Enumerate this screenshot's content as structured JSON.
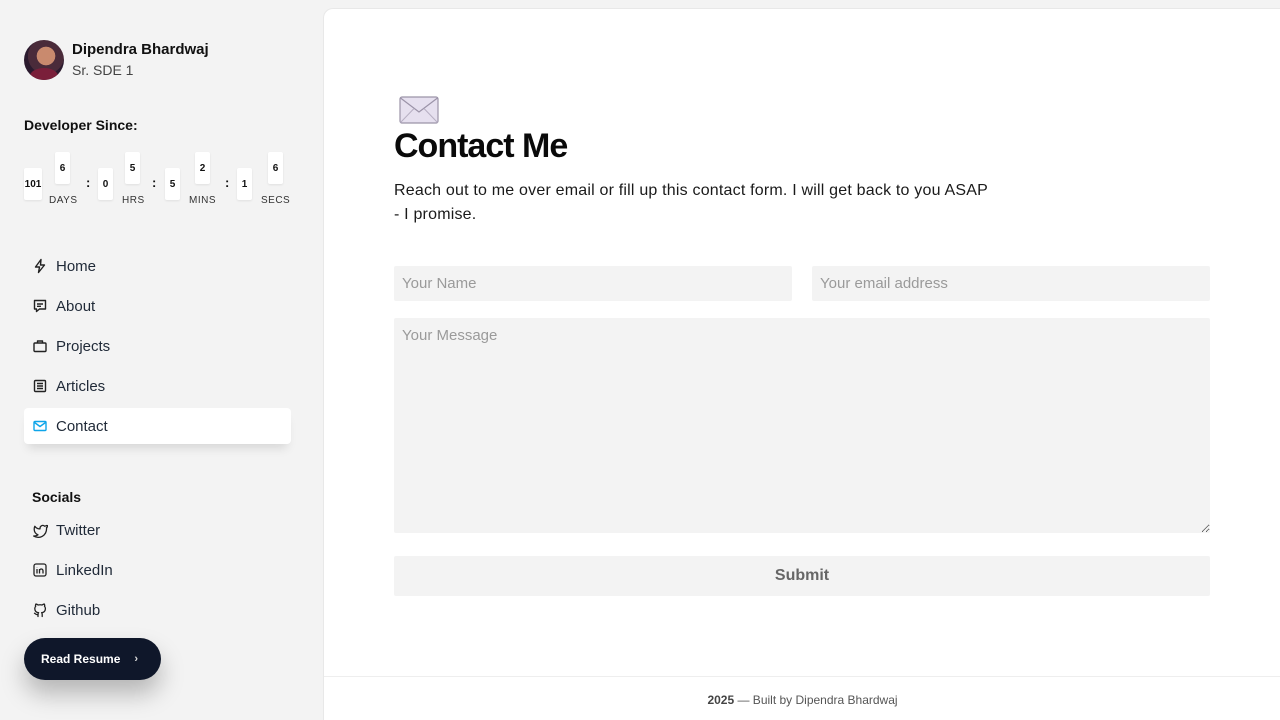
{
  "profile": {
    "name": "Dipendra Bhardwaj",
    "role": "Sr. SDE 1"
  },
  "developer_since": {
    "title": "Developer Since:",
    "days": {
      "hundreds": "101",
      "units": "6",
      "label": "DAYS"
    },
    "hours": {
      "tens": "0",
      "units": "5",
      "label": "HRS"
    },
    "mins": {
      "tens": "5",
      "units": "2",
      "label": "MINS"
    },
    "secs": {
      "tens": "1",
      "units": "6",
      "label": "SECS"
    },
    "separator": ":"
  },
  "nav": {
    "items": [
      {
        "label": "Home",
        "icon": "bolt-icon"
      },
      {
        "label": "About",
        "icon": "message-icon"
      },
      {
        "label": "Projects",
        "icon": "briefcase-icon"
      },
      {
        "label": "Articles",
        "icon": "article-icon"
      },
      {
        "label": "Contact",
        "icon": "mail-icon",
        "active": true
      }
    ]
  },
  "socials": {
    "title": "Socials",
    "items": [
      {
        "label": "Twitter",
        "icon": "twitter-icon"
      },
      {
        "label": "LinkedIn",
        "icon": "linkedin-icon"
      },
      {
        "label": "Github",
        "icon": "github-icon"
      }
    ]
  },
  "resume": {
    "label": "Read Resume",
    "icon": "chevron-right-icon"
  },
  "main": {
    "icon": "envelope-icon",
    "title": "Contact Me",
    "description": "Reach out to me over email or fill up this contact form. I will get back to you ASAP - I promise.",
    "form": {
      "name_placeholder": "Your Name",
      "email_placeholder": "Your email address",
      "message_placeholder": "Your Message",
      "submit_label": "Submit"
    }
  },
  "footer": {
    "year": "2025",
    "text": " — Built by Dipendra Bhardwaj"
  },
  "colors": {
    "accent": "#0ea5e9",
    "button_dark": "#0f172a",
    "page_bg": "#f3f3f3"
  }
}
